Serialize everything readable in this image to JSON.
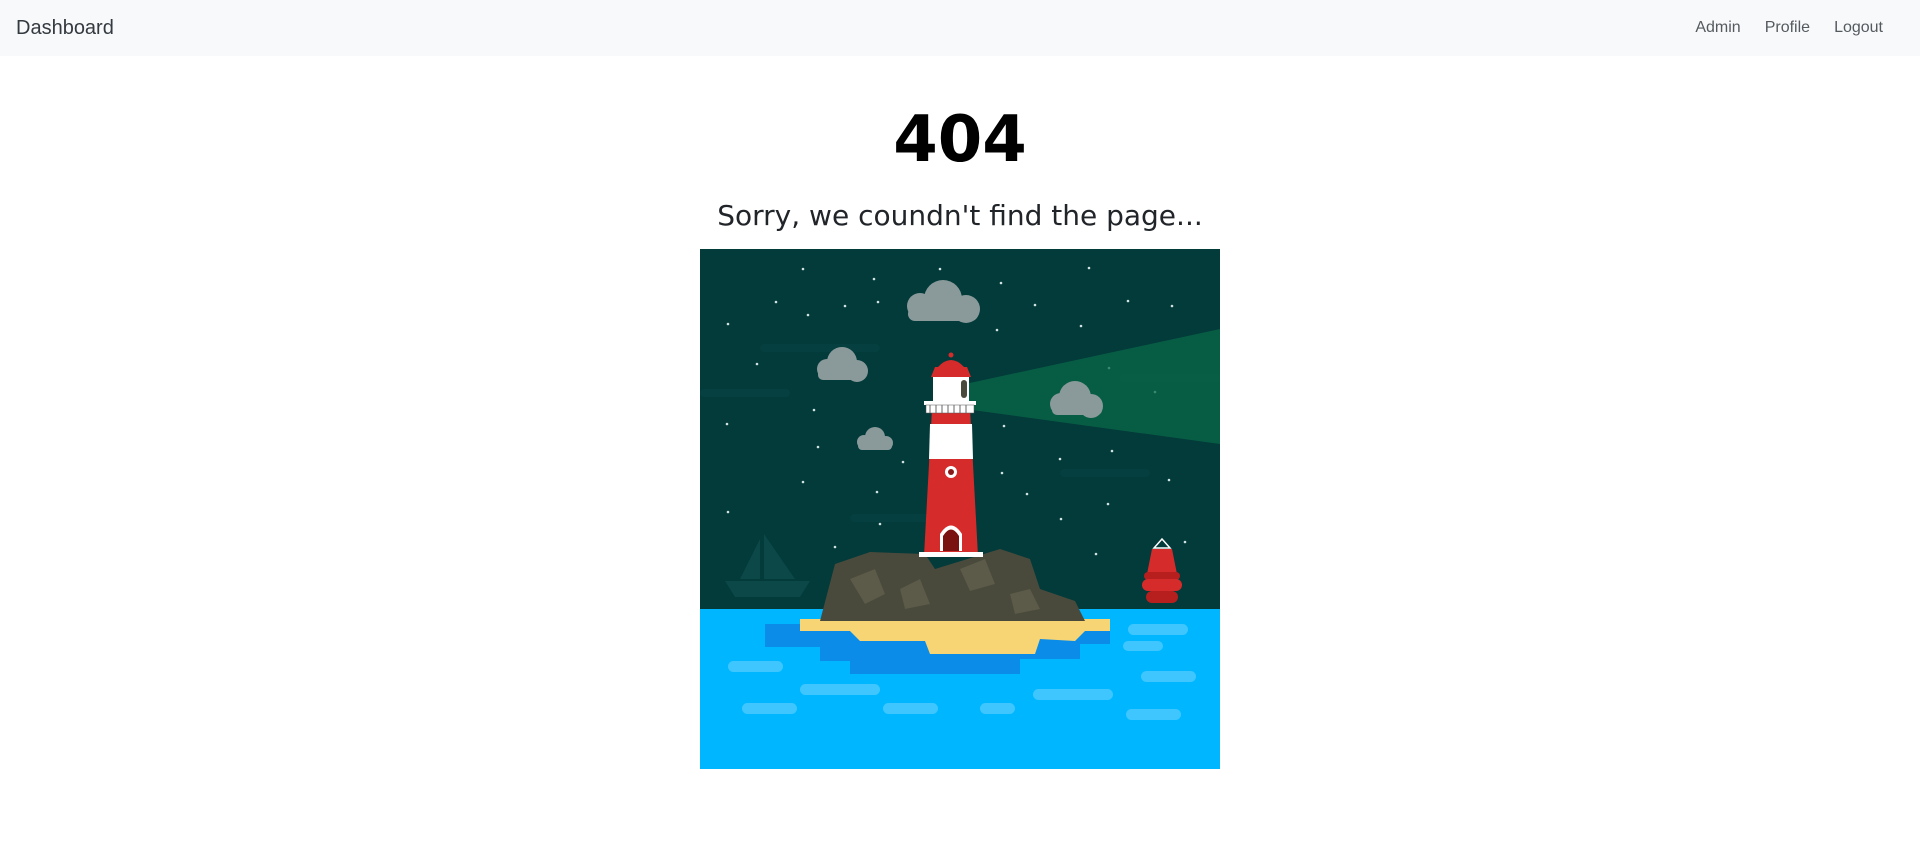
{
  "navbar": {
    "brand": "Dashboard",
    "links": [
      "Admin",
      "Profile",
      "Logout"
    ]
  },
  "main": {
    "code": "404",
    "message": "Sorry, we coundn't find the page..."
  },
  "colors": {
    "navbar_bg": "#f8f9fa",
    "sky": "#033a3a",
    "sea": "#00b7ff",
    "lighthouse_red": "#d62b2b"
  }
}
